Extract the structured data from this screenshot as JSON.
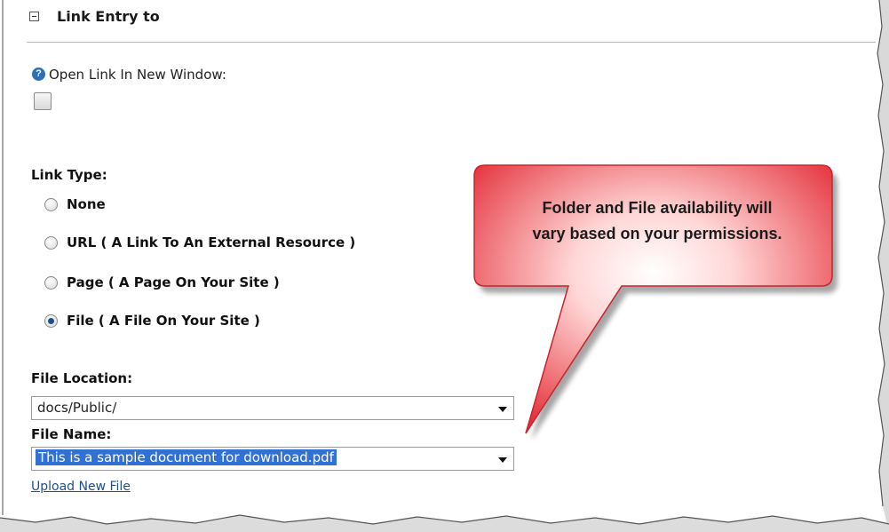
{
  "section": {
    "title": "Link Entry to"
  },
  "open_new_window": {
    "help_icon": "question-circle-icon",
    "help_glyph": "?",
    "label": "Open Link In New Window:",
    "checked": false
  },
  "link_type": {
    "label": "Link Type:",
    "options": [
      {
        "label": "None",
        "selected": false
      },
      {
        "label": "URL ( A Link To An External Resource )",
        "selected": false
      },
      {
        "label": "Page ( A Page On Your Site )",
        "selected": false
      },
      {
        "label": "File ( A File On Your Site )",
        "selected": true
      }
    ]
  },
  "file_location": {
    "label": "File Location:",
    "value": "docs/Public/"
  },
  "file_name": {
    "label": "File Name:",
    "value": "This is a sample document for download.pdf"
  },
  "upload_link": "Upload New File",
  "callout": {
    "line1": "Folder and File availability will",
    "line2": "vary based on your permissions.",
    "fill_color": "#e8303a"
  }
}
